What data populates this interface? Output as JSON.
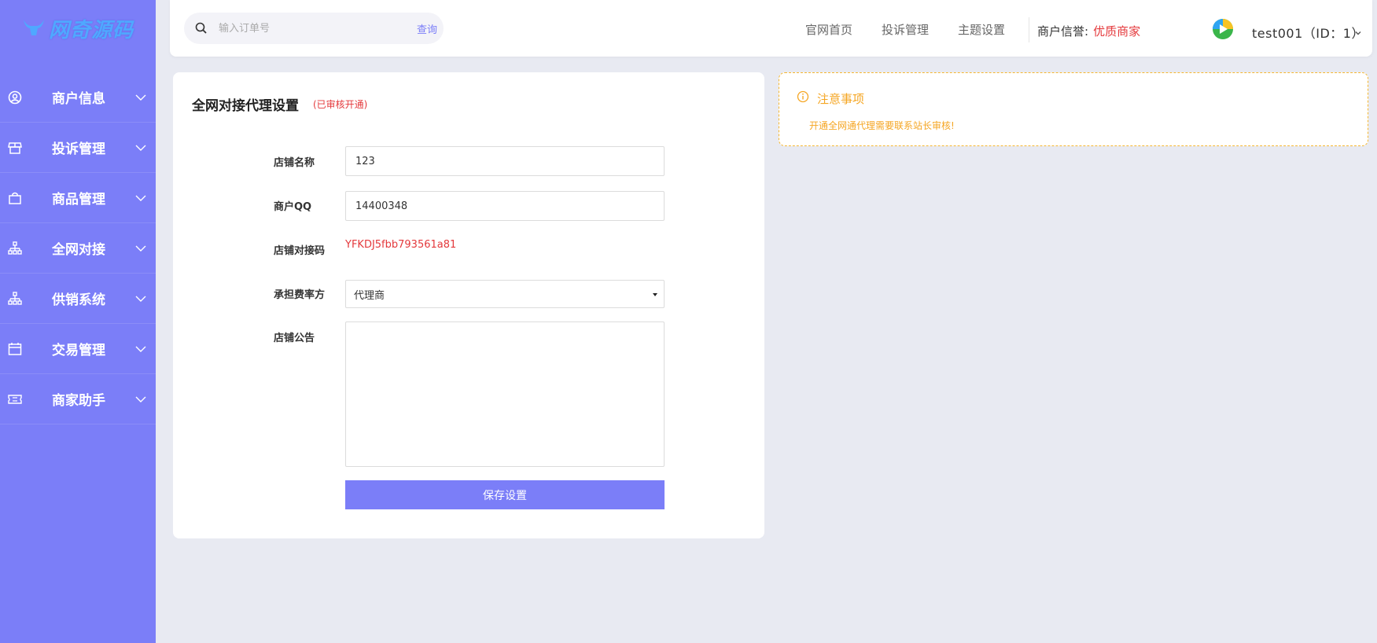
{
  "brand": {
    "logo_text": "网奇源码",
    "accent": "#7b7ef8"
  },
  "sidebar": {
    "items": [
      {
        "label": "商户信息",
        "icon": "user-circle-icon"
      },
      {
        "label": "投诉管理",
        "icon": "store-icon"
      },
      {
        "label": "商品管理",
        "icon": "shopping-bag-icon"
      },
      {
        "label": "全网对接",
        "icon": "sitemap-icon"
      },
      {
        "label": "供销系统",
        "icon": "sitemap-icon"
      },
      {
        "label": "交易管理",
        "icon": "calendar-icon"
      },
      {
        "label": "商家助手",
        "icon": "ticket-icon"
      }
    ]
  },
  "header": {
    "search": {
      "placeholder": "输入订单号",
      "button": "查询"
    },
    "links": [
      "官网首页",
      "投诉管理",
      "主题设置"
    ],
    "reputation": {
      "label": "商户信誉:",
      "value": "优质商家"
    },
    "user": "test001（ID：1）"
  },
  "form": {
    "title": "全网对接代理设置",
    "status": "(已审核开通)",
    "fields": {
      "shop_name": {
        "label": "店铺名称",
        "value": "123"
      },
      "qq": {
        "label": "商户QQ",
        "value": "14400348"
      },
      "code": {
        "label": "店铺对接码",
        "value": "YFKDJ5fbb793561a81"
      },
      "fee": {
        "label": "承担费率方",
        "value": "代理商"
      },
      "notice": {
        "label": "店铺公告",
        "value": ""
      }
    },
    "save_label": "保存设置"
  },
  "notice_box": {
    "title": "注意事项",
    "body": "开通全网通代理需要联系站长审核!"
  }
}
